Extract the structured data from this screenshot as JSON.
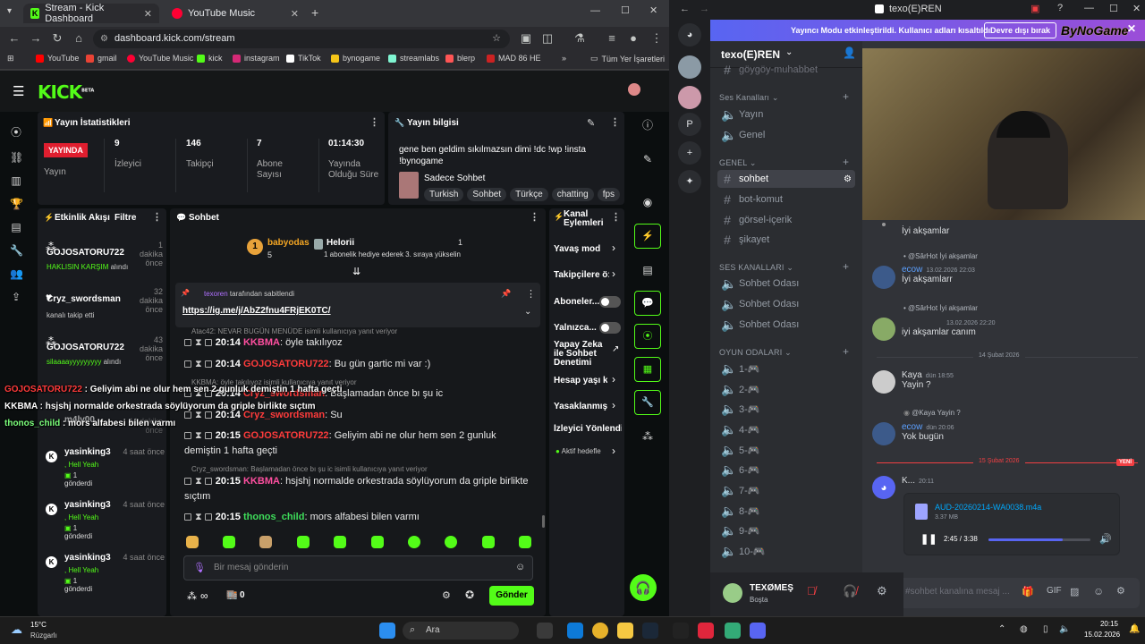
{
  "browser": {
    "tabs": [
      {
        "label": "Stream - Kick Dashboard",
        "active": true
      },
      {
        "label": "YouTube Music",
        "active": false
      }
    ],
    "url": "dashboard.kick.com/stream",
    "bookmarks": [
      "YouTube",
      "gmail",
      "YouTube Music",
      "kick",
      "instagram",
      "TikTok",
      "bynogame",
      "streamlabs",
      "blerp",
      "MAD 86 HE"
    ],
    "all_bookmarks": "Tüm Yer İşaretleri",
    "bm_more": "»"
  },
  "kick": {
    "logo": "KICK",
    "logo_sup": "BETA",
    "stats": {
      "title": "Yayın İstatistikleri",
      "live_badge": "YAYINDA",
      "live_label": "Yayın",
      "items": [
        {
          "value": "9",
          "label": "İzleyici"
        },
        {
          "value": "146",
          "label": "Takipçi"
        },
        {
          "value": "7",
          "label": "Abone Sayısı"
        },
        {
          "value": "01:14:30",
          "label": "Yayında Olduğu Süre"
        }
      ]
    },
    "info": {
      "title": "Yayın bilgisi",
      "stream_title": "gene ben geldim sıkılmazsın dimi !dc !wp !insta !bynogame",
      "category": "Sadece Sohbet",
      "tags": [
        "Turkish",
        "Sohbet",
        "Türkçe",
        "chatting",
        "fps"
      ]
    },
    "activity": {
      "title": "Etkinlik Akışı",
      "filter": "Filtre",
      "events": [
        {
          "user": "GOJOSATORU722",
          "time": "1 dakika önce",
          "detail": "HAKLISIN KARŞIM",
          "suffix": "alındı",
          "icon": "gift-icon"
        },
        {
          "user": "Cryz_swordsman",
          "time": "32 dakika önce",
          "detail": "kanalı takip etti",
          "suffix": "",
          "icon": "heart-icon"
        },
        {
          "user": "GOJOSATORU722",
          "time": "43 dakika önce",
          "detail": "silaaaayyyyyyyyy",
          "suffix": "alındı",
          "icon": "gift-icon"
        },
        {
          "user": "m4lv00",
          "time": "44 dakika önce",
          "detail": "",
          "suffix": "",
          "icon": "gift-icon"
        },
        {
          "user": "yasinking3",
          "time": "4 saat önce",
          "detail": ", Hell Yeah",
          "count": "1",
          "suffix": "gönderdi",
          "icon": "kick-icon"
        },
        {
          "user": "yasinking3",
          "time": "4 saat önce",
          "detail": ", Hell Yeah",
          "count": "1",
          "suffix": "gönderdi",
          "icon": "kick-icon"
        },
        {
          "user": "yasinking3",
          "time": "4 saat önce",
          "detail": ", Hell Yeah",
          "count": "1",
          "suffix": "gönderdi",
          "icon": "kick-icon"
        }
      ]
    },
    "chat": {
      "title": "Sohbet",
      "gift_user1": "babyodas",
      "gift_count1": "5",
      "gift_user2": "Helorii",
      "gift_count2": "1",
      "gift_text": "1 abonelik hediye ederek 3. sıraya yükselin",
      "pinned_by": "texoren",
      "pinned_suffix": "tarafından sabitlendi",
      "pinned_link": "https://ig.me/j/AbZ2fnu4FRjEK0TC/",
      "messages": [
        {
          "reply": "Atac42: NEVAR BUGÜN MENÜDE isimli kullanıcıya yanıt veriyor",
          "time": "20:14",
          "user": "KKBMA",
          "text": "öyle takılıyoz",
          "color": "pink"
        },
        {
          "reply": "",
          "time": "20:14",
          "user": "GOJOSATORU722",
          "text": "Bu gün gartic mi var :)",
          "color": "red"
        },
        {
          "reply": "KKBMA: öyle takılıyoz isimli kullanıcıya yanıt veriyor",
          "time": "20:14",
          "user": "Cryz_swordsman",
          "text": "Başlamadan önce bı şu ic",
          "color": "red"
        },
        {
          "reply": "",
          "time": "20:14",
          "user": "Cryz_swordsman",
          "text": "Su",
          "color": "red"
        },
        {
          "reply": "",
          "time": "20:15",
          "user": "GOJOSATORU722",
          "text": "Geliyim abi ne olur hem sen 2 gunluk demiştin 1 hafta geçti",
          "color": "red"
        },
        {
          "reply": "Cryz_swordsman: Başlamadan önce bı şu ic isimli kullanıcıya yanıt veriyor",
          "time": "20:15",
          "user": "KKBMA",
          "text": "hsjshj normalde orkestrada söylüyorum da griple birlikte sıçtım",
          "color": "pink"
        },
        {
          "reply": "",
          "time": "20:15",
          "user": "thonos_child",
          "text": "mors alfabesi bilen varmı",
          "color": "green"
        }
      ],
      "input_placeholder": "Bir mesaj gönderin",
      "send": "Gönder",
      "points": "∞",
      "count": "0"
    },
    "actions": {
      "title": "Kanal Eylemleri",
      "items": [
        "Yavaş mod",
        "Takipçilere ö:",
        "Aboneler...",
        "Yalnızca...",
        "Yapay Zeka ile Sohbet Denetimi",
        "Hesap yaşı k:",
        "Yasaklanmış",
        "İzleyici Yönlendir"
      ],
      "active_hint": "Aktif hedefle"
    },
    "overlay": [
      {
        "user": "GOJOSATORU722",
        "text": "Geliyim abi ne olur hem sen 2 gunluk demiştin 1 hafta geçti"
      },
      {
        "user": "KKBMA",
        "text": "hsjshj normalde orkestrada söylüyorum da griple birlikte sıçtım"
      },
      {
        "user": "thonos_child",
        "text": "mors alfabesi bilen varmı"
      }
    ]
  },
  "discord": {
    "window_title": "texo(E)REN",
    "banner": "Yayıncı Modu etkinleştirildi. Kullanıcı adları kısaltıldı.",
    "banner_btn": "Devre dışı bırak",
    "banner_brand": "ByNoGame",
    "server_name": "texo(E)REN",
    "channels": [
      {
        "type": "text",
        "name": "göygöy-muhabbet"
      },
      {
        "type": "cat",
        "name": "Ses Kanalları"
      },
      {
        "type": "voice",
        "name": "Yayın"
      },
      {
        "type": "voice",
        "name": "Genel"
      },
      {
        "type": "cat",
        "name": "GENEL"
      },
      {
        "type": "text",
        "name": "sohbet",
        "selected": true
      },
      {
        "type": "text",
        "name": "bot-komut"
      },
      {
        "type": "text",
        "name": "görsel-içerik"
      },
      {
        "type": "text",
        "name": "şikayet"
      },
      {
        "type": "cat",
        "name": "SES KANALLARI"
      },
      {
        "type": "voice",
        "name": "Sohbet Odası"
      },
      {
        "type": "voice",
        "name": "Sohbet Odası"
      },
      {
        "type": "voice",
        "name": "Sohbet Odası"
      },
      {
        "type": "cat",
        "name": "OYUN ODALARI"
      },
      {
        "type": "voice",
        "name": "1-🎮"
      },
      {
        "type": "voice",
        "name": "2-🎮"
      },
      {
        "type": "voice",
        "name": "3-🎮"
      },
      {
        "type": "voice",
        "name": "4-🎮"
      },
      {
        "type": "voice",
        "name": "5-🎮"
      },
      {
        "type": "voice",
        "name": "6-🎮"
      },
      {
        "type": "voice",
        "name": "7-🎮"
      },
      {
        "type": "voice",
        "name": "8-🎮"
      },
      {
        "type": "voice",
        "name": "9-🎮"
      },
      {
        "type": "voice",
        "name": "10-🎮"
      }
    ],
    "user": {
      "name": "TEXØMEŞ",
      "status": "Boşta"
    },
    "messages": [
      {
        "reply": "",
        "user": "",
        "time": "",
        "text": "İyi akşamlar"
      },
      {
        "reply": "@SârHot İyi akşamlar",
        "user": "ecow",
        "time": "13.02.2026 22:03",
        "text": "İyi akşamlarr"
      },
      {
        "reply": "@SârHot İyi akşamlar",
        "user": "",
        "time": "13.02.2026 22:20",
        "text": "iyi akşamlar canım"
      },
      {
        "reply": "",
        "user": "Kaya",
        "time": "dün 18:55",
        "text": "Yayin ?"
      },
      {
        "reply": "@Kaya Yayin ?",
        "user": "ecow",
        "time": "dün 20:06",
        "text": "Yok bugün"
      }
    ],
    "date_divider1": "14 Şubat 2026",
    "date_divider2": "15 Şubat 2026",
    "new_badge": "YENİ",
    "attach_user": "K...",
    "attach_time": "20:11",
    "attachment": {
      "name": "AUD-20260214-WA0038.m4a",
      "size": "3.37 MB",
      "time": "2:45 / 3:38",
      "progress": 0.73
    },
    "input_placeholder": "#sohbet kanalına mesaj ..."
  },
  "taskbar": {
    "temp": "15°C",
    "weather": "Rüzgarlı",
    "search": "Ara",
    "time": "20:15",
    "date": "15.02.2026"
  }
}
